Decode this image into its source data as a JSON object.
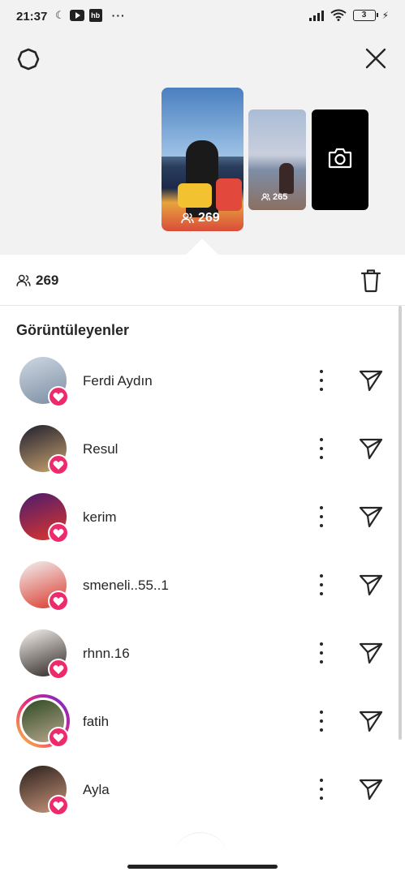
{
  "status_bar": {
    "time": "21:37",
    "hb_label": "hb",
    "dots": "···",
    "battery": "3"
  },
  "story_strip": {
    "main_thumb_count": "269",
    "second_thumb_count": "265"
  },
  "viewer_count": "269",
  "list": {
    "title": "Görüntüleyenler",
    "viewers": [
      {
        "name": "Ferdi Aydın",
        "avatar_colors": [
          "#cfd8e2",
          "#7a8da3"
        ],
        "has_ring": false
      },
      {
        "name": "Resul",
        "avatar_colors": [
          "#1f1e2e",
          "#c9a46e"
        ],
        "has_ring": false
      },
      {
        "name": "kerim",
        "avatar_colors": [
          "#4a1c6e",
          "#e0372b"
        ],
        "has_ring": false
      },
      {
        "name": "smeneli..55..1",
        "avatar_colors": [
          "#f2f2f2",
          "#d9382b"
        ],
        "has_ring": false
      },
      {
        "name": "rhnn.16",
        "avatar_colors": [
          "#f7f3ee",
          "#2b2320"
        ],
        "has_ring": false
      },
      {
        "name": "fatih",
        "avatar_colors": [
          "#2e4a24",
          "#b8a78d"
        ],
        "has_ring": true
      },
      {
        "name": "Ayla",
        "avatar_colors": [
          "#2a1f1b",
          "#c9967c"
        ],
        "has_ring": false
      }
    ]
  },
  "colors": {
    "heart_badge": "#ed2b6c",
    "story_ring": [
      "#f9ce34",
      "#ee2a7b",
      "#6228d7"
    ]
  },
  "icons": {
    "settings": "gear-icon",
    "close": "close-icon",
    "camera": "camera-icon",
    "viewers": "people-icon",
    "delete": "trash-icon",
    "more": "more-vertical-icon",
    "send": "send-icon",
    "liked": "heart-icon"
  }
}
